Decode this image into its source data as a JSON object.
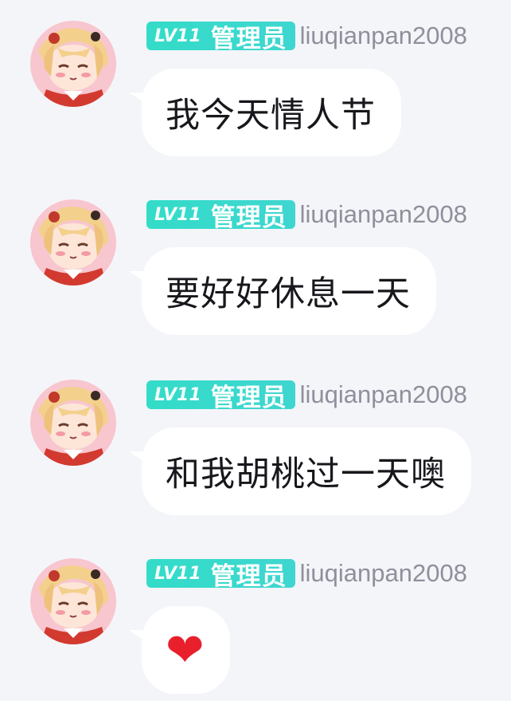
{
  "messages": [
    {
      "level": "LV11",
      "role": "管理员",
      "username": "liuqianpan2008",
      "text": "我今天情人节"
    },
    {
      "level": "LV11",
      "role": "管理员",
      "username": "liuqianpan2008",
      "text": "要好好休息一天"
    },
    {
      "level": "LV11",
      "role": "管理员",
      "username": "liuqianpan2008",
      "text": "和我胡桃过一天噢"
    },
    {
      "level": "LV11",
      "role": "管理员",
      "username": "liuqianpan2008",
      "emoji": "❤"
    }
  ],
  "colors": {
    "background": "#f4f5f9",
    "badge": "#3fd6d0",
    "bubble": "#ffffff",
    "username": "#8e909c",
    "heart": "#e8202b"
  }
}
